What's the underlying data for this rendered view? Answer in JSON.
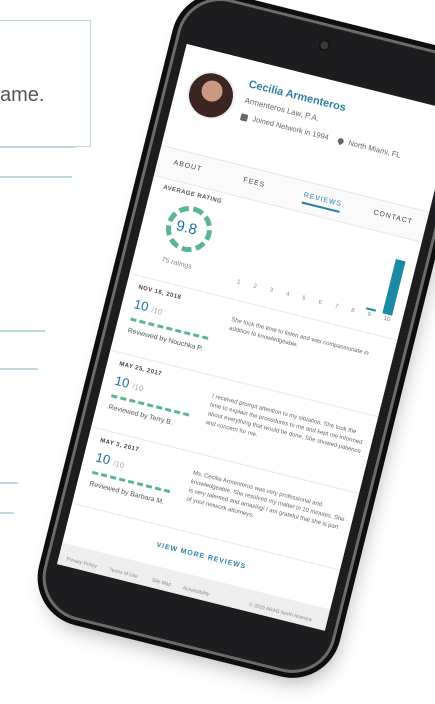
{
  "background": {
    "fragment_text": "ame."
  },
  "profile": {
    "name": "Cecilia Armenteros",
    "firm": "Armenteros Law, P.A.",
    "joined": "Joined Network in 1994",
    "location": "North Miami, FL"
  },
  "tabs": [
    {
      "label": "ABOUT"
    },
    {
      "label": "FEES"
    },
    {
      "label": "REVIEWS"
    },
    {
      "label": "CONTACT"
    }
  ],
  "rating": {
    "label": "AVERAGE RATING",
    "score": "9.8",
    "count": "75 ratings"
  },
  "chart_data": {
    "type": "bar",
    "categories": [
      "1",
      "2",
      "3",
      "4",
      "5",
      "6",
      "7",
      "8",
      "9",
      "10"
    ],
    "values": [
      0,
      0,
      0,
      0,
      0,
      0,
      0,
      0,
      2,
      73
    ]
  },
  "reviews": [
    {
      "date": "NOV 16, 2018",
      "score": "10",
      "max": "/10",
      "by": "Reviewed by Nouchka P.",
      "text": "She took the time to listen and was compassionate in addition to knowledgeable."
    },
    {
      "date": "MAY 25, 2017",
      "score": "10",
      "max": "/10",
      "by": "Reviewed by Terry B.",
      "text": "I received prompt attention to my situation. She took the time to explain the procedures to me and kept me informed about everything that would be done. She showed patience and concern for me."
    },
    {
      "date": "MAY 3, 2017",
      "score": "10",
      "max": "/10",
      "by": "Reviewed by Barbara M.",
      "text": "Ms. Cecilia Armenteros was very professional and knowledgeable. She resolved my matter in 10 minutes. She is very talented and amazing! I am grateful that she is part of your network attorneys."
    }
  ],
  "view_more": "VIEW MORE REVIEWS",
  "footer": {
    "links": [
      "Privacy Policy",
      "Terms of Use",
      "Site Map",
      "Accessibility"
    ],
    "copyright": "© 2019 ARAG North America"
  },
  "colors": {
    "accent": "#2b7fa6",
    "rating_green": "#5ab591",
    "bar_teal": "#1d8aa3"
  }
}
